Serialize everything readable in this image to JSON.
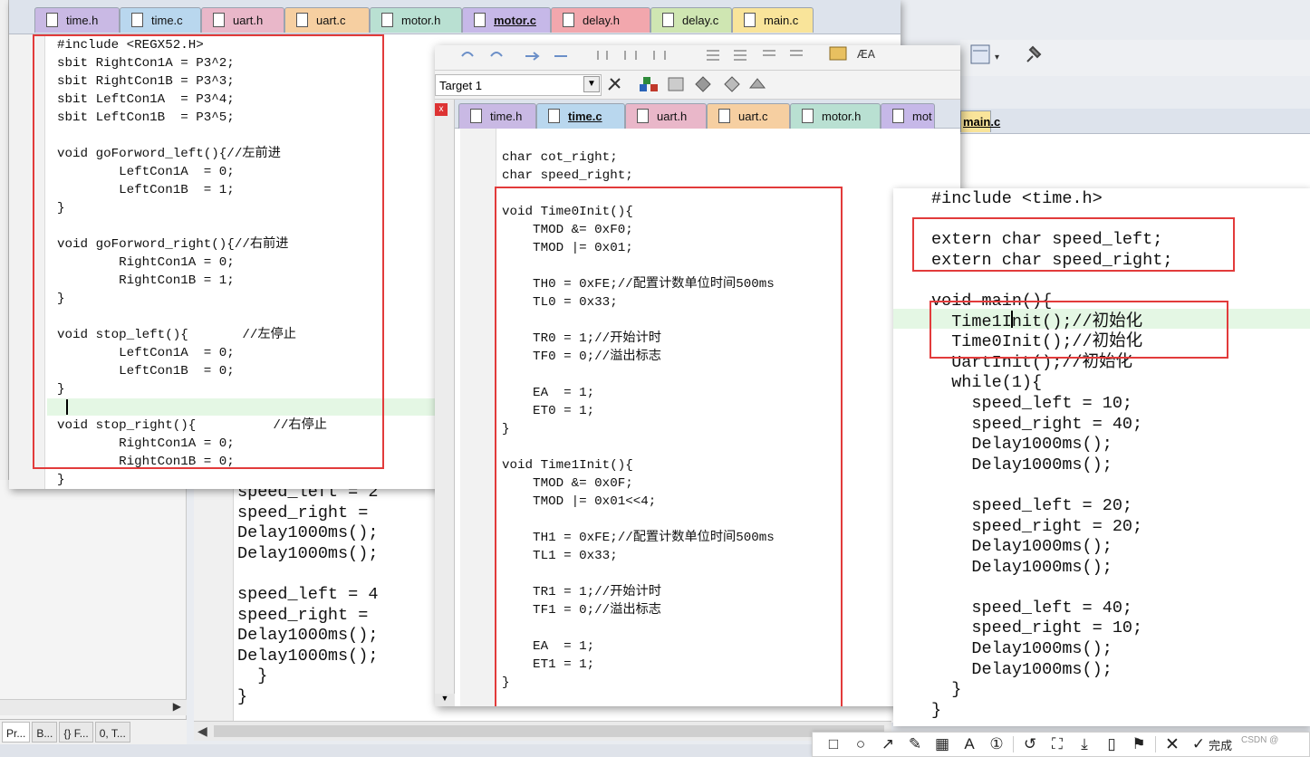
{
  "background_ide": {
    "code_lines": [
      "speed_left = 2",
      "speed_right = ",
      "Delay1000ms();",
      "Delay1000ms();",
      "",
      "speed_left = 4",
      "speed_right = ",
      "Delay1000ms();",
      "Delay1000ms();",
      "  }",
      "}"
    ],
    "project_tabs": [
      "Pr...",
      "B...",
      "{} F...",
      "0, T..."
    ],
    "right_tab": "main.c"
  },
  "window1": {
    "tabs": [
      "time.h",
      "time.c",
      "uart.h",
      "uart.c",
      "motor.h",
      "motor.c",
      "delay.h",
      "delay.c",
      "main.c"
    ],
    "active_tab": "motor.c",
    "tab_colors": [
      "#c9b9e4",
      "#b9d7ee",
      "#e9b7c9",
      "#f6cfa1",
      "#b9e0d2",
      "#c6b8e8",
      "#f2a7ad",
      "#cfe6b2",
      "#f9e49a"
    ],
    "code_lines": [
      "#include <REGX52.H>",
      "sbit RightCon1A = P3^2;",
      "sbit RightCon1B = P3^3;",
      "sbit LeftCon1A  = P3^4;",
      "sbit LeftCon1B  = P3^5;",
      "",
      "void goForword_left(){//左前进",
      "        LeftCon1A  = 0;",
      "        LeftCon1B  = 1;",
      "}",
      "",
      "void goForword_right(){//右前进",
      "        RightCon1A = 0;",
      "        RightCon1B = 1;",
      "}",
      "",
      "void stop_left(){       //左停止",
      "        LeftCon1A  = 0;",
      "        LeftCon1B  = 0;",
      "}",
      "",
      "void stop_right(){          //右停止",
      "        RightCon1A = 0;",
      "        RightCon1B = 0;",
      "}"
    ]
  },
  "window2": {
    "target": "Target 1",
    "tabs": [
      "time.h",
      "time.c",
      "uart.h",
      "uart.c",
      "motor.h",
      "mot"
    ],
    "active_tab": "time.c",
    "tab_colors": [
      "#c9b9e4",
      "#b9d7ee",
      "#e9b7c9",
      "#f6cfa1",
      "#b9e0d2",
      "#c6b8e8"
    ],
    "close_label": "x",
    "code_lines": [
      "char cot_right;",
      "char speed_right;",
      "",
      "void Time0Init(){",
      "    TMOD &= 0xF0;",
      "    TMOD |= 0x01;",
      "",
      "    TH0 = 0xFE;//配置计数单位时间500ms",
      "    TL0 = 0x33;",
      "",
      "    TR0 = 1;//开始计时",
      "    TF0 = 0;//溢出标志",
      "",
      "    EA  = 1;",
      "    ET0 = 1;",
      "}",
      "",
      "void Time1Init(){",
      "    TMOD &= 0x0F;",
      "    TMOD |= 0x01<<4;",
      "",
      "    TH1 = 0xFE;//配置计数单位时间500ms",
      "    TL1 = 0x33;",
      "",
      "    TR1 = 1;//开始计时",
      "    TF1 = 0;//溢出标志",
      "",
      "    EA  = 1;",
      "    ET1 = 1;",
      "}"
    ]
  },
  "window3": {
    "code_lines": [
      "#include <time.h>",
      "",
      "extern char speed_left;",
      "extern char speed_right;",
      "",
      "void main(){",
      "  Time1Init();//初始化",
      "  Time0Init();//初始化",
      "  UartInit();//初始化",
      "  while(1){",
      "    speed_left = 10;",
      "    speed_right = 40;",
      "    Delay1000ms();",
      "    Delay1000ms();",
      "",
      "    speed_left = 20;",
      "    speed_right = 20;",
      "    Delay1000ms();",
      "    Delay1000ms();",
      "",
      "    speed_left = 40;",
      "    speed_right = 10;",
      "    Delay1000ms();",
      "    Delay1000ms();",
      "  }",
      "}"
    ]
  },
  "snip_toolbar": {
    "icons": [
      "rectangle-icon",
      "ellipse-icon",
      "arrow-icon",
      "pen-icon",
      "mosaic-icon",
      "text-icon",
      "number-icon",
      "undo-icon",
      "ocr-icon",
      "download-icon",
      "pin-icon",
      "bookmark-icon",
      "cancel-icon",
      "done-icon"
    ],
    "icon_glyphs": [
      "□",
      "○",
      "↗",
      "✎",
      "▦",
      "A",
      "①",
      "↺",
      "⛶",
      "⤓",
      "▯",
      "⚑",
      "✕",
      "✓"
    ],
    "done_label": "完成",
    "watermark": "CSDN @"
  }
}
